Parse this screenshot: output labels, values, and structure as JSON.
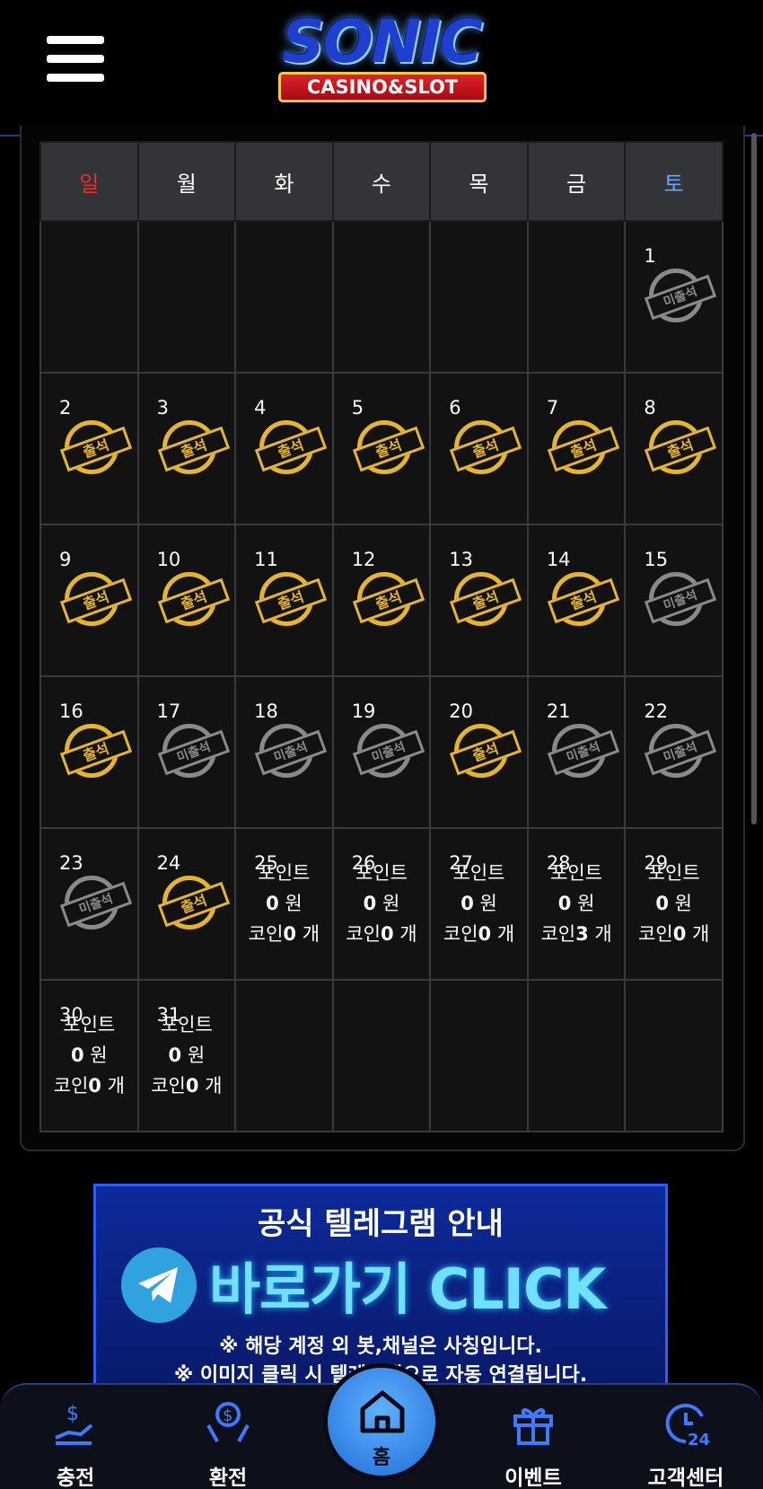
{
  "header": {
    "logo_main": "SONIC",
    "logo_sub": "CASINO&SLOT"
  },
  "calendar": {
    "weekdays": [
      "일",
      "월",
      "화",
      "수",
      "목",
      "금",
      "토"
    ],
    "attend_label": "출석",
    "absent_label": "미출석",
    "reward_point_label": "포인트",
    "reward_point_unit": "원",
    "reward_coin_label": "코인",
    "reward_coin_unit": "개",
    "weeks": [
      [
        null,
        null,
        null,
        null,
        null,
        null,
        {
          "day": "1",
          "status": "absent"
        }
      ],
      [
        {
          "day": "2",
          "status": "attend"
        },
        {
          "day": "3",
          "status": "attend"
        },
        {
          "day": "4",
          "status": "attend"
        },
        {
          "day": "5",
          "status": "attend"
        },
        {
          "day": "6",
          "status": "attend"
        },
        {
          "day": "7",
          "status": "attend"
        },
        {
          "day": "8",
          "status": "attend"
        }
      ],
      [
        {
          "day": "9",
          "status": "attend"
        },
        {
          "day": "10",
          "status": "attend"
        },
        {
          "day": "11",
          "status": "attend"
        },
        {
          "day": "12",
          "status": "attend"
        },
        {
          "day": "13",
          "status": "attend"
        },
        {
          "day": "14",
          "status": "attend"
        },
        {
          "day": "15",
          "status": "absent"
        }
      ],
      [
        {
          "day": "16",
          "status": "attend"
        },
        {
          "day": "17",
          "status": "absent"
        },
        {
          "day": "18",
          "status": "absent"
        },
        {
          "day": "19",
          "status": "absent"
        },
        {
          "day": "20",
          "status": "attend"
        },
        {
          "day": "21",
          "status": "absent"
        },
        {
          "day": "22",
          "status": "absent"
        }
      ],
      [
        {
          "day": "23",
          "status": "absent"
        },
        {
          "day": "24",
          "status": "attend"
        },
        {
          "day": "25",
          "status": "future",
          "points": "0",
          "coins": "0"
        },
        {
          "day": "26",
          "status": "future",
          "points": "0",
          "coins": "0"
        },
        {
          "day": "27",
          "status": "future",
          "points": "0",
          "coins": "0"
        },
        {
          "day": "28",
          "status": "future",
          "points": "0",
          "coins": "3"
        },
        {
          "day": "29",
          "status": "future",
          "points": "0",
          "coins": "0"
        }
      ],
      [
        {
          "day": "30",
          "status": "future",
          "points": "0",
          "coins": "0"
        },
        {
          "day": "31",
          "status": "future",
          "points": "0",
          "coins": "0"
        },
        null,
        null,
        null,
        null,
        null
      ]
    ]
  },
  "banner": {
    "title": "공식 텔레그램 안내",
    "cta": "바로가기 CLICK",
    "note1": "※ 해당 계정 외 봇,채널은 사칭입니다.",
    "note2": "※ 이미지 클릭 시 텔레그램으로 자동 연결됩니다."
  },
  "nav": {
    "deposit": "충전",
    "withdraw": "환전",
    "home": "홈",
    "event": "이벤트",
    "support": "고객센터"
  },
  "colors": {
    "sunday": "#e53030",
    "saturday": "#63a8ff",
    "attend": "#e6b52a",
    "absent": "#8a8a8a",
    "accent": "#1f6fd8"
  }
}
